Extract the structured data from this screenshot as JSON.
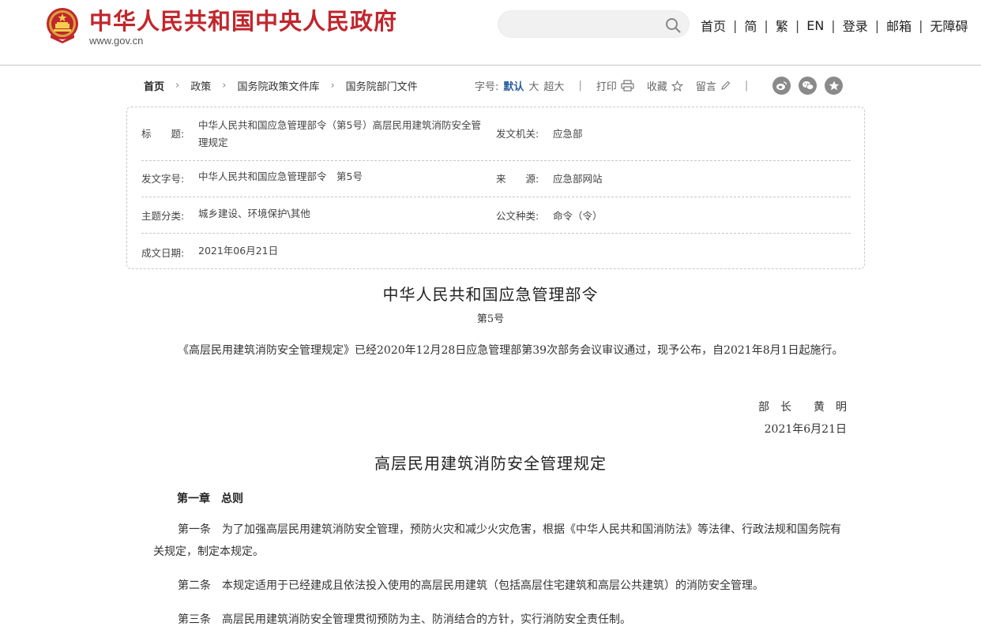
{
  "header": {
    "site_title": "中华人民共和国中央人民政府",
    "site_url": "www.gov.cn",
    "search_placeholder": "",
    "nav": [
      "首页",
      "简",
      "繁",
      "EN",
      "登录",
      "邮箱",
      "无障碍"
    ],
    "nav_separator": "|"
  },
  "breadcrumb": {
    "items": [
      "首页",
      "政策",
      "国务院政策文件库",
      "国务院部门文件"
    ],
    "arrow": "›"
  },
  "tools": {
    "font_size_label": "字号:",
    "font_sizes": [
      "默认",
      "大",
      "超大"
    ],
    "separator": "|",
    "print": "打印",
    "favorite": "收藏",
    "comment": "留言"
  },
  "share_icons": [
    "weibo-icon",
    "wechat-icon",
    "favorite-star-icon"
  ],
  "info": {
    "title_label": "标　　题:",
    "title_value": "中华人民共和国应急管理部令（第5号）高层民用建筑消防安全管理规定",
    "issuer_label": "发文机关:",
    "issuer_value": "应急部",
    "doc_number_label": "发文字号:",
    "doc_number_value": "中华人民共和国应急管理部令　第5号",
    "source_label": "来　　源:",
    "source_value": "应急部网站",
    "category_label": "主题分类:",
    "category_value": "城乡建设、环境保护\\其他",
    "doc_type_label": "公文种类:",
    "doc_type_value": "命令（令）",
    "date_label": "成文日期:",
    "date_value": "2021年06月21日"
  },
  "document": {
    "order_title": "中华人民共和国应急管理部令",
    "order_number": "第5号",
    "announcement": "《高层民用建筑消防安全管理规定》已经2020年12月28日应急管理部第39次部务会议审议通过，现予公布，自2021年8月1日起施行。",
    "signature": "部　长　　黄　明",
    "sign_date": "2021年6月21日",
    "regulation_title": "高层民用建筑消防安全管理规定",
    "chapter_1": "第一章　总则",
    "article_1": "第一条　为了加强高层民用建筑消防安全管理，预防火灾和减少火灾危害，根据《中华人民共和国消防法》等法律、行政法规和国务院有关规定，制定本规定。",
    "article_2": "第二条　本规定适用于已经建成且依法投入使用的高层民用建筑（包括高层住宅建筑和高层公共建筑）的消防安全管理。",
    "article_3": "第三条　高层民用建筑消防安全管理贯彻预防为主、防消结合的方针，实行消防安全责任制。"
  },
  "colors": {
    "brand_red": "#c0272d",
    "link_blue": "#2a5d9f",
    "share_gray": "#8a8a8a"
  }
}
